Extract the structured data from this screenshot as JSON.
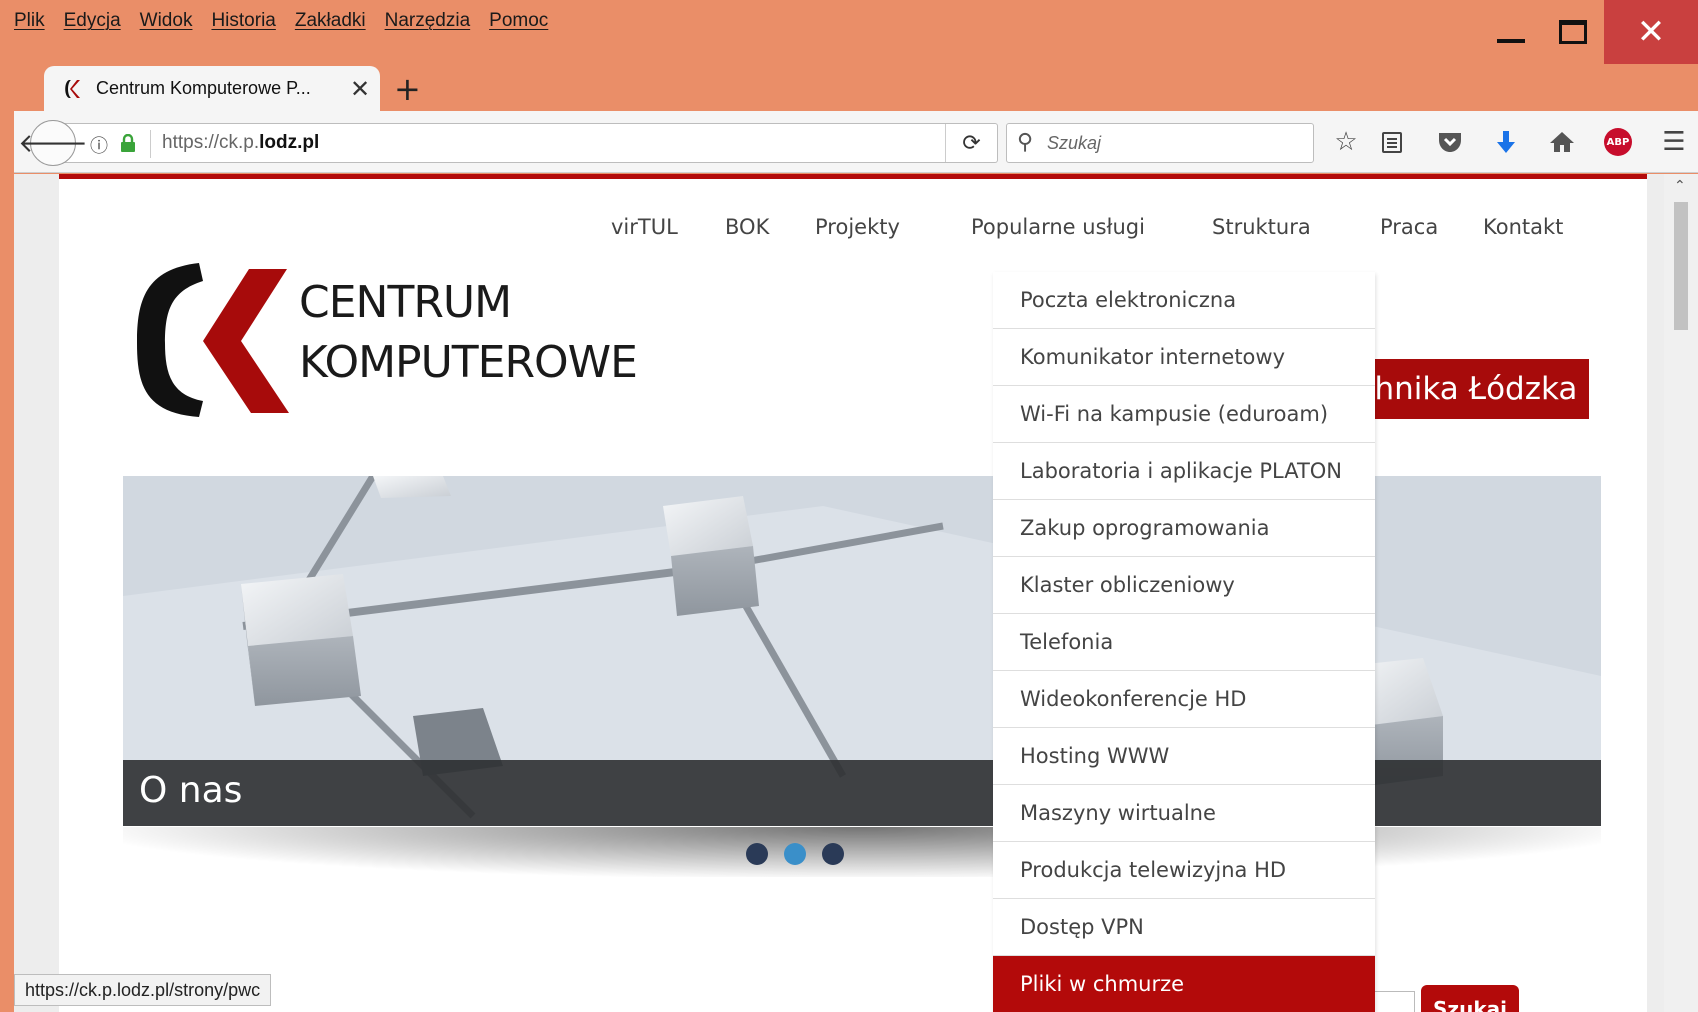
{
  "menubar": [
    "Plik",
    "Edycja",
    "Widok",
    "Historia",
    "Zakładki",
    "Narzędzia",
    "Pomoc"
  ],
  "window_controls": {
    "close": "✕"
  },
  "tab": {
    "title": "Centrum Komputerowe P...",
    "close": "✕",
    "new_tab": "+"
  },
  "navbar": {
    "url_prefix": "https://ck.p.",
    "url_domain": "lodz.pl",
    "search_placeholder": "Szukaj",
    "abp_label": "ABP"
  },
  "site": {
    "nav": [
      "virTUL",
      "BOK",
      "Projekty",
      "Popularne usługi",
      "Struktura",
      "Praca",
      "Kontakt"
    ],
    "logo_line1": "CENTRUM",
    "logo_line2": "KOMPUTEROWE",
    "banner_text": "litechnika Łódzka",
    "slide_caption": "O nas",
    "search_button": "Szukaj",
    "brand_red": "#b30a0a"
  },
  "dropdown": {
    "items": [
      "Poczta elektroniczna",
      "Komunikator internetowy",
      "Wi-Fi na kampusie (eduroam)",
      "Laboratoria i aplikacje PLATON",
      "Zakup oprogramowania",
      "Klaster obliczeniowy",
      "Telefonia",
      "Wideokonferencje HD",
      "Hosting WWW",
      "Maszyny wirtualne",
      "Produkcja telewizyjna HD",
      "Dostęp VPN",
      "Pliki w chmurze"
    ],
    "active_index": 12
  },
  "status_url": "https://ck.p.lodz.pl/strony/pwc"
}
